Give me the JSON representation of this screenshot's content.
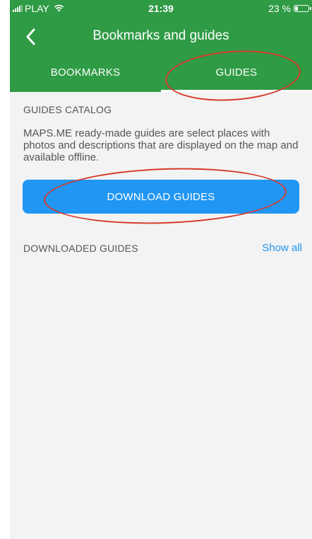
{
  "status_bar": {
    "carrier": "PLAY",
    "time": "21:39",
    "battery": "23 %",
    "battery_level": 0.23
  },
  "header": {
    "title": "Bookmarks and guides"
  },
  "tabs": [
    {
      "label": "BOOKMARKS",
      "active": false
    },
    {
      "label": "GUIDES",
      "active": true
    }
  ],
  "guides_catalog": {
    "title": "GUIDES CATALOG",
    "description": "MAPS.ME ready-made guides are select places with photos and descriptions that are displayed on the map and available offline.",
    "download_button": "DOWNLOAD GUIDES"
  },
  "downloaded_guides": {
    "title": "DOWNLOADED GUIDES",
    "show_all": "Show all"
  },
  "colors": {
    "header_green": "#2f9b45",
    "button_blue": "#2196f3",
    "annotation_red": "#d63a2a",
    "background": "#f3f3f3"
  },
  "icons": [
    "signal-icon",
    "wifi-icon",
    "battery-icon",
    "back-chevron-icon"
  ]
}
